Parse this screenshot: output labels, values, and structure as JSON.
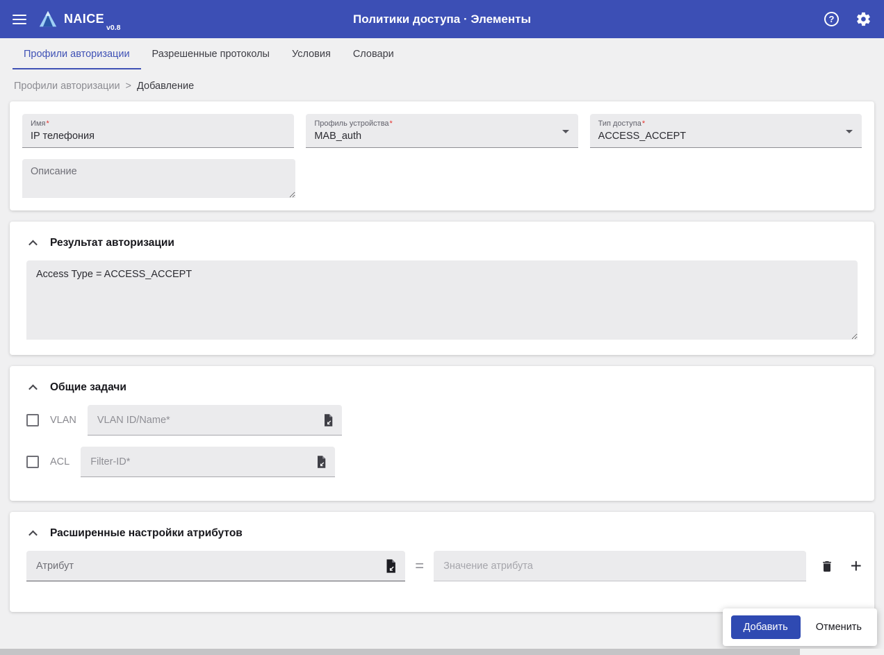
{
  "app_bar": {
    "brand": "NAICE",
    "version": "v0.8",
    "title": "Политики доступа · Элементы"
  },
  "icons": {
    "help": "?",
    "plus": "+"
  },
  "tabs": [
    {
      "label": "Профили авторизации",
      "active": true
    },
    {
      "label": "Разрешенные протоколы",
      "active": false
    },
    {
      "label": "Условия",
      "active": false
    },
    {
      "label": "Словари",
      "active": false
    }
  ],
  "breadcrumb": {
    "parent": "Профили авторизации",
    "separator": ">",
    "current": "Добавление"
  },
  "form": {
    "name": {
      "label": "Имя",
      "required_mark": "*",
      "value": "IP телефония"
    },
    "device_profile": {
      "label": "Профиль устройства",
      "required_mark": "*",
      "value": "MAB_auth"
    },
    "access_type": {
      "label": "Тип доступа",
      "required_mark": "*",
      "value": "ACCESS_ACCEPT"
    },
    "description": {
      "placeholder": "Описание",
      "value": ""
    }
  },
  "authorization_result": {
    "title": "Результат авторизации",
    "value": "Access Type = ACCESS_ACCEPT"
  },
  "common_tasks": {
    "title": "Общие задачи",
    "rows": [
      {
        "checkbox": "VLAN",
        "placeholder": "VLAN ID/Name*",
        "checked": false
      },
      {
        "checkbox": "ACL",
        "placeholder": "Filter-ID*",
        "checked": false
      }
    ]
  },
  "advanced_attributes": {
    "title": "Расширенные настройки атрибутов",
    "attribute_placeholder": "Атрибут",
    "equals": "=",
    "value_placeholder": "Значение атрибута"
  },
  "actions": {
    "add": "Добавить",
    "cancel": "Отменить"
  },
  "colors": {
    "appbar": "#3C4FB5",
    "primary": "#2F4AB2",
    "active_tab": "#3F51B5",
    "required": "#E5322D"
  }
}
